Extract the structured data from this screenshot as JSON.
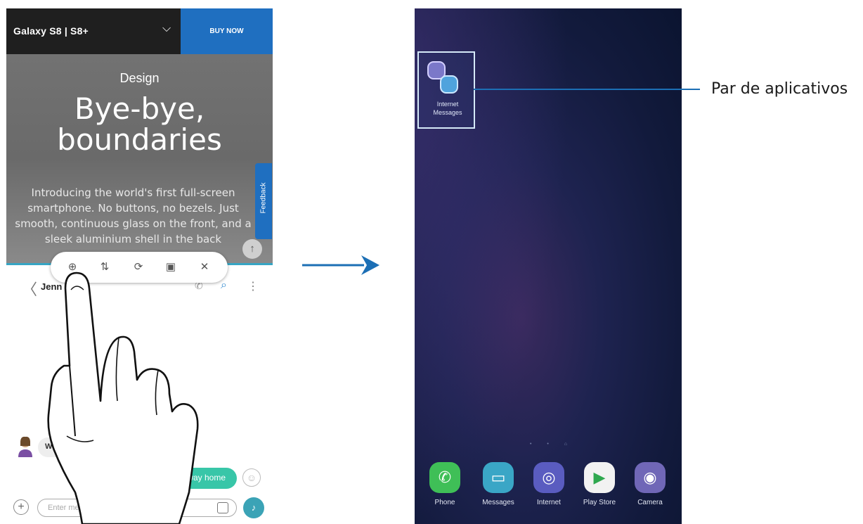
{
  "left_phone": {
    "topbar": {
      "model": "Galaxy S8  |  S8+",
      "chevron": "⌵",
      "buy_now": "BUY NOW"
    },
    "hero": {
      "eyebrow": "Design",
      "headline_1": "Bye-bye,",
      "headline_2": "boundaries",
      "body": "Introducing the world's first full-screen smartphone. No buttons, no bezels. Just smooth, continuous glass on the front, and a sleek aluminium shell in the back"
    },
    "feedback_label": "Feedback",
    "scroll_top": "↑",
    "popup_icons": [
      "add-app-pair-icon",
      "swap-windows-icon",
      "rotate-icon",
      "pop-up-view-icon",
      "close-icon"
    ],
    "popup_glyphs": [
      "⊕",
      "⇅",
      "⟳",
      "▣",
      "✕"
    ],
    "messages": {
      "back": "〈",
      "contact_name": "Jenn",
      "incoming_text": "Wh",
      "outgoing_text": "my way home",
      "compose_placeholder": "Enter mess",
      "plus": "+",
      "search": "⌕",
      "more": "⋮",
      "call": "✆"
    }
  },
  "right_phone": {
    "app_pair": {
      "label_1": "Internet",
      "label_2": "Messages"
    },
    "dock": [
      {
        "name": "Phone",
        "icon": "phone-icon",
        "glyph": "✆",
        "color": "#3fbf57"
      },
      {
        "name": "Messages",
        "icon": "messages-icon",
        "glyph": "▭",
        "color": "#3aa6c6"
      },
      {
        "name": "Internet",
        "icon": "internet-icon",
        "glyph": "◎",
        "color": "#5a5cc0"
      },
      {
        "name": "Play Store",
        "icon": "play-store-icon",
        "glyph": "▶",
        "color": "#f2f2f2"
      },
      {
        "name": "Camera",
        "icon": "camera-icon",
        "glyph": "◉",
        "color": "#7067b7"
      }
    ]
  },
  "callout": {
    "label": "Par de aplicativos"
  },
  "colors": {
    "accent_blue": "#1f6fc0",
    "callout_line": "#1c6fb5",
    "teal": "#38c6a8"
  }
}
